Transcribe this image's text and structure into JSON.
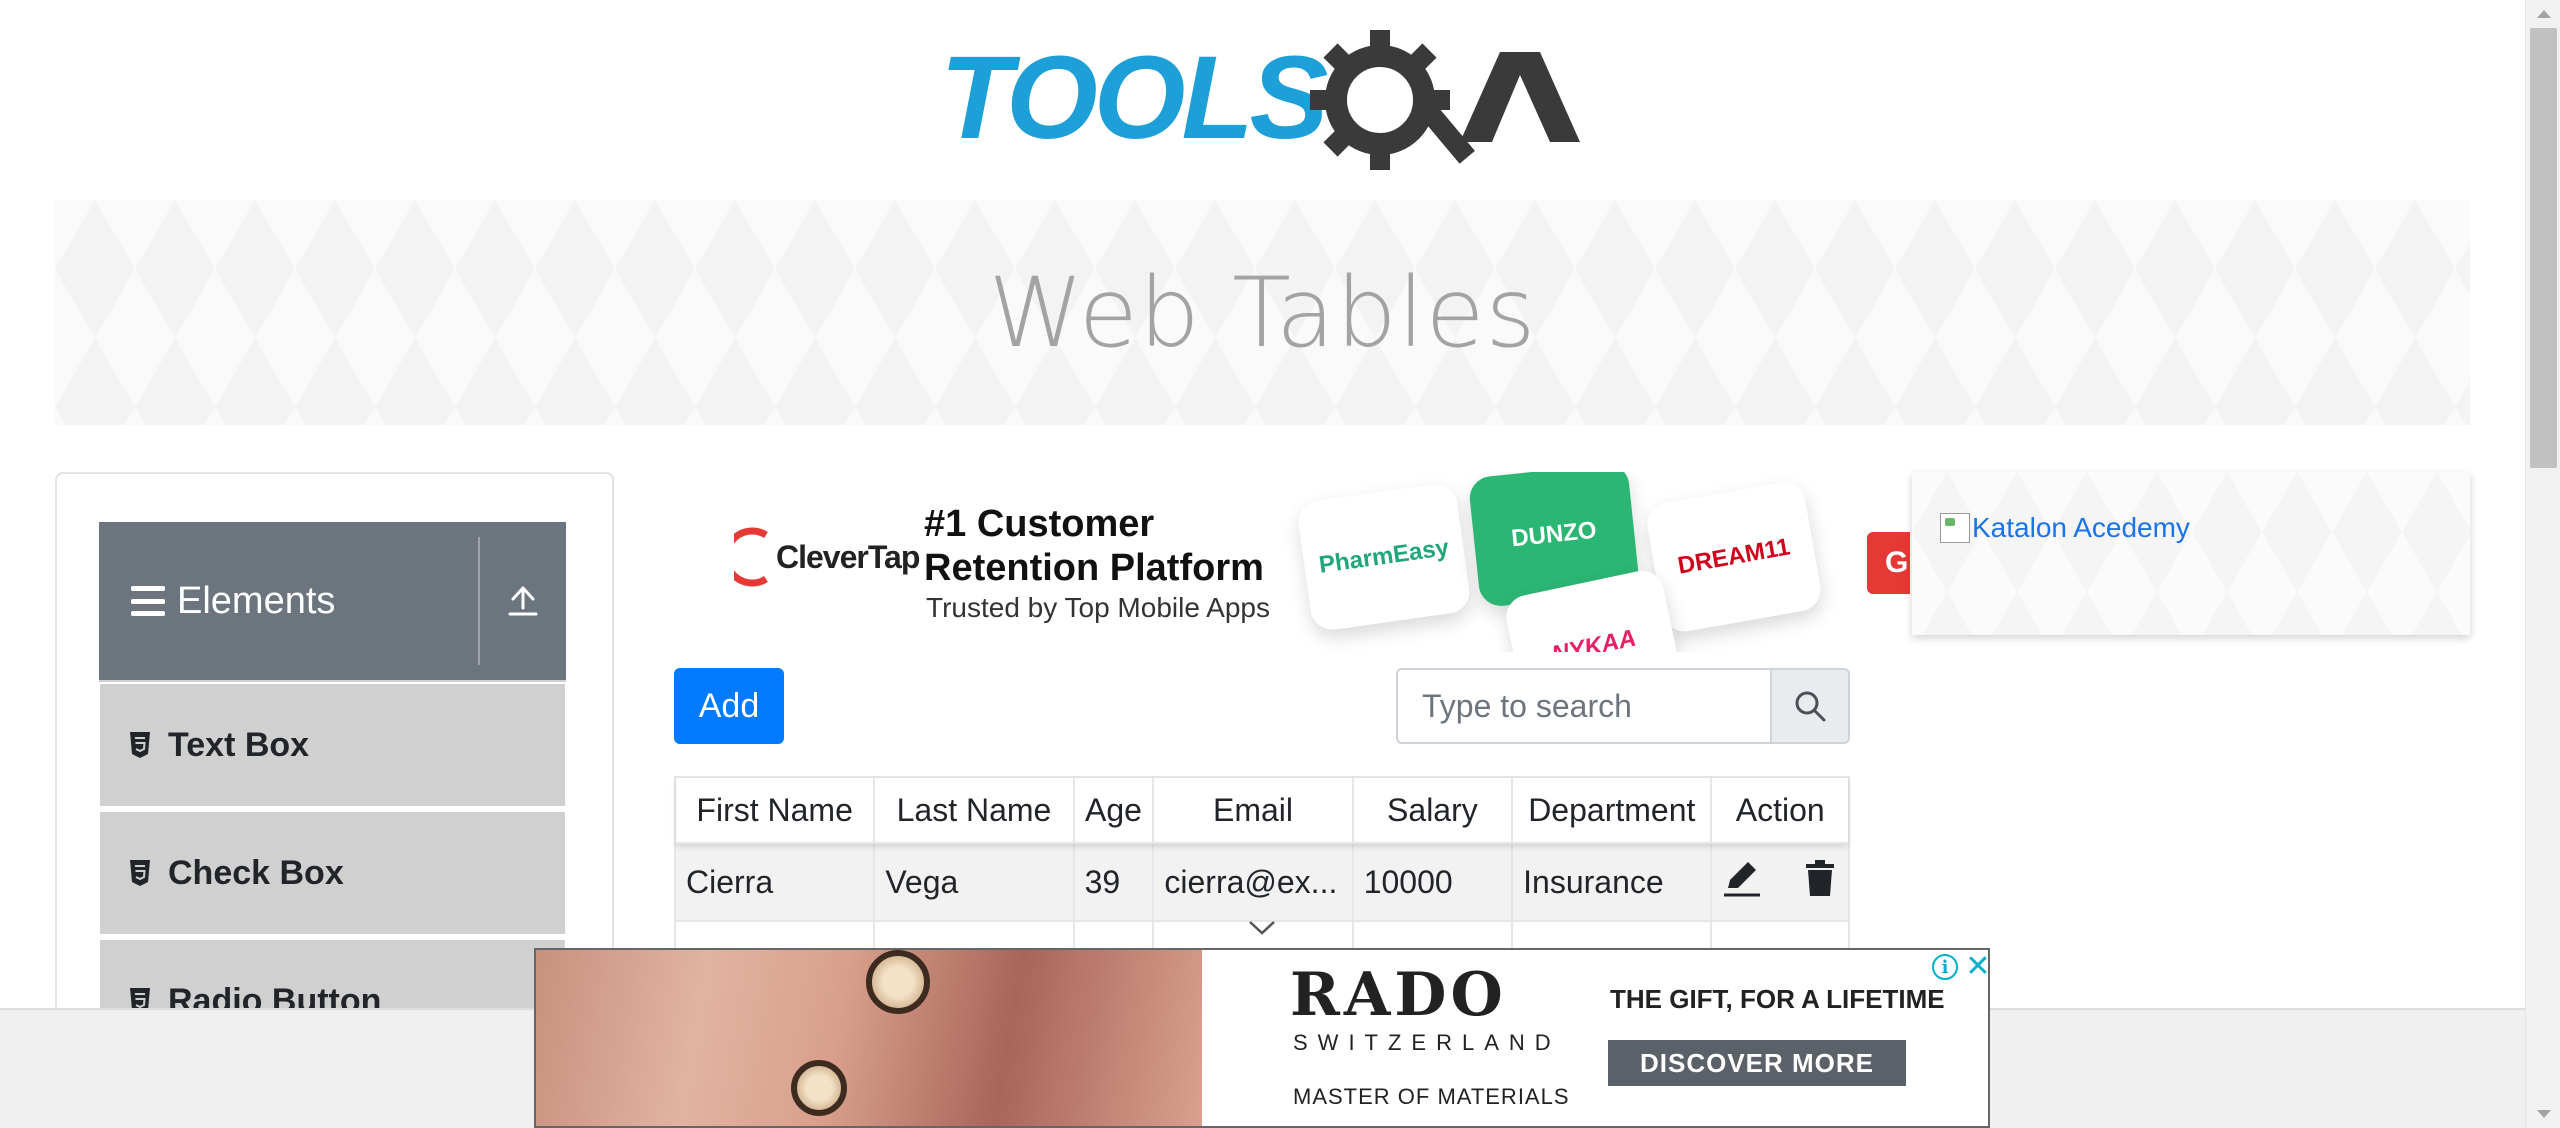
{
  "header": {
    "logo_text": "TOOLSQA"
  },
  "banner": {
    "title": "Web Tables"
  },
  "sidebar": {
    "group": {
      "label": "Elements"
    },
    "items": [
      {
        "label": "Text Box"
      },
      {
        "label": "Check Box"
      },
      {
        "label": "Radio Button"
      }
    ]
  },
  "ad_top": {
    "brand": "CleverTap",
    "headline_line1": "#1 Customer",
    "headline_line2": "Retention Platform",
    "sub": "Trusted by Top Mobile Apps",
    "apps": [
      "PharmEasy",
      "DUNZO",
      "DREAM11",
      "NYKAA"
    ],
    "cta": "G"
  },
  "ad_right": {
    "alt_text": "Katalon Acedemy"
  },
  "controls": {
    "add_label": "Add",
    "search_placeholder": "Type to search"
  },
  "table": {
    "headers": [
      "First Name",
      "Last Name",
      "Age",
      "Email",
      "Salary",
      "Department",
      "Action"
    ],
    "rows": [
      {
        "first": "Cierra",
        "last": "Vega",
        "age": "39",
        "email": "cierra@ex...",
        "salary": "10000",
        "department": "Insurance"
      }
    ]
  },
  "ad_bottom": {
    "brand": "RADO",
    "country": "SWITZERLAND",
    "tagline": "MASTER OF MATERIALS",
    "headline": "THE GIFT, FOR A LIFETIME",
    "cta": "DISCOVER MORE"
  },
  "colors": {
    "primary": "#007bff",
    "sidebar_header": "#6c757d",
    "menu_item": "#d0d0d0",
    "logo_blue": "#1d9fd8",
    "logo_dark": "#3a3a3a"
  },
  "icons": [
    "hamburger-icon",
    "upload-icon",
    "html5-icon",
    "search-icon",
    "pencil-icon",
    "trash-icon",
    "chevron-down-icon",
    "info-icon",
    "close-icon"
  ]
}
